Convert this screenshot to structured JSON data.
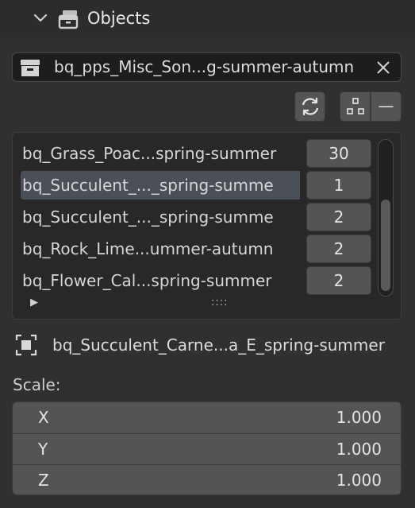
{
  "panel": {
    "title": "Objects",
    "title_icon": "collection-box-icon",
    "expander_icon": "chevron-down-icon"
  },
  "collection": {
    "value": "bq_pps_Misc_Son...g-summer-autumn",
    "icon": "collection-box-icon",
    "clear_icon": "close-icon"
  },
  "toolbar": {
    "refresh_icon": "refresh-icon",
    "scatter_icon": "scatter-points-icon",
    "remove_label": "—"
  },
  "list": {
    "items": [
      {
        "name": "bq_Grass_Poac...spring-summer",
        "count": "30",
        "selected": false
      },
      {
        "name": "bq_Succulent_..._spring-summe",
        "count": "1",
        "selected": true
      },
      {
        "name": "bq_Succulent_..._spring-summe",
        "count": "2",
        "selected": false
      },
      {
        "name": "bq_Rock_Lime...ummer-autumn",
        "count": "2",
        "selected": false
      },
      {
        "name": "bq_Flower_Cal...spring-summer",
        "count": "2",
        "selected": false
      }
    ],
    "expand_glyph": "▶",
    "grip_glyph": "::::"
  },
  "active_object": {
    "name": "bq_Succulent_Carne...a_E_spring-summer",
    "icon": "object-icon"
  },
  "scale": {
    "label": "Scale:",
    "x_label": "X",
    "x_value": "1.000",
    "y_label": "Y",
    "y_value": "1.000",
    "z_label": "Z",
    "z_value": "1.000"
  },
  "colors": {
    "background": "#303030",
    "field_dark": "#1d1d1d",
    "button": "#545454",
    "selection": "#4b5058",
    "text": "#e0e0e0"
  }
}
